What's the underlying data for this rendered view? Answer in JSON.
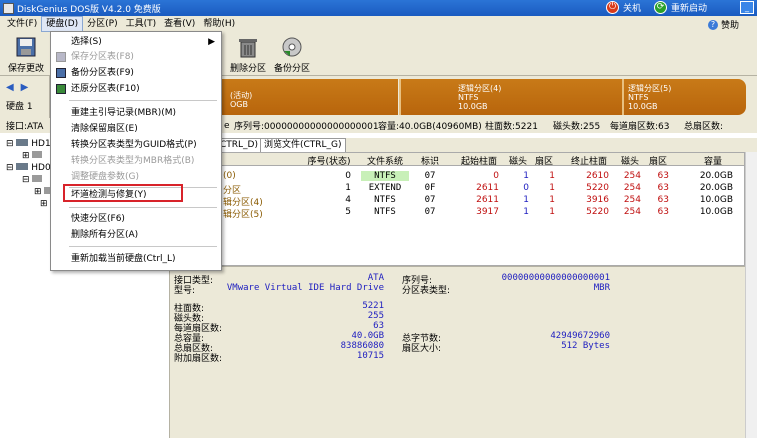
{
  "title": "DiskGenius DOS版 V4.2.0 免费版",
  "titlebar": {
    "shutdown": "关机",
    "restart": "重新启动"
  },
  "menubar": {
    "items": [
      "文件(F)",
      "硬盘(D)",
      "分区(P)",
      "工具(T)",
      "查看(V)",
      "帮助(H)"
    ],
    "donate": "赞助"
  },
  "toolbar": {
    "save_label": "保存更改",
    "delete_label": "删除分区",
    "backup_label": "备份分区"
  },
  "leftpanel": {
    "disk_label": "硬盘 1",
    "iface_label": "接口:ATA"
  },
  "diskbar": {
    "seg1_l1": "(活动)",
    "seg1_l2": "OGB",
    "seg2_l1": "逻辑分区(4)",
    "seg2_l2": "NTFS",
    "seg2_l3": "10.0GB",
    "seg3_l1": "逻辑分区(5)",
    "seg3_l2": "NTFS",
    "seg3_l3": "10.0GB"
  },
  "infoline": {
    "model_tail": "e",
    "serial": "序列号:00000000000000000001",
    "capacity": "容量:40.0GB(40960MB)",
    "cylinders": "柱面数:5221",
    "heads": "磁头数:255",
    "sectors": "每道扇区数:63",
    "total": "总扇区数:"
  },
  "tabs": {
    "t1": "CTRL_D)",
    "t2": "浏览文件(CTRL_G)"
  },
  "table": {
    "headers": [
      "序号(状态)",
      "文件系统",
      "标识",
      "起始柱面",
      "磁头",
      "扇区",
      "终止柱面",
      "磁头",
      "扇区",
      "容量"
    ],
    "rows": [
      {
        "name": "(0)",
        "idx": "0",
        "fs": "NTFS",
        "id": "07",
        "sc": "0",
        "sh": "1",
        "ss": "1",
        "ec": "2610",
        "eh": "254",
        "es": "63",
        "cap": "20.0GB"
      },
      {
        "name": "分区",
        "idx": "1",
        "fs": "EXTEND",
        "id": "0F",
        "sc": "2611",
        "sh": "0",
        "ss": "1",
        "ec": "5220",
        "eh": "254",
        "es": "63",
        "cap": "20.0GB"
      },
      {
        "name": "辑分区(4)",
        "idx": "4",
        "fs": "NTFS",
        "id": "07",
        "sc": "2611",
        "sh": "1",
        "ss": "1",
        "ec": "3916",
        "eh": "254",
        "es": "63",
        "cap": "10.0GB"
      },
      {
        "name": "辑分区(5)",
        "idx": "5",
        "fs": "NTFS",
        "id": "07",
        "sc": "3917",
        "sh": "1",
        "ss": "1",
        "ec": "5220",
        "eh": "254",
        "es": "63",
        "cap": "10.0GB"
      }
    ]
  },
  "details": {
    "iface_k": "接口类型:",
    "iface_v": "ATA",
    "model_k": "型号:",
    "model_v": "VMware Virtual IDE Hard Drive",
    "serial_k": "序列号:",
    "serial_v": "00000000000000000001",
    "ptype_k": "分区表类型:",
    "ptype_v": "MBR",
    "cyl_k": "柱面数:",
    "cyl_v": "5221",
    "heads_k": "磁头数:",
    "heads_v": "255",
    "spt_k": "每道扇区数:",
    "spt_v": "63",
    "cap_k": "总容量:",
    "cap_v": "40.0GB",
    "tsec_k": "总扇区数:",
    "tsec_v": "83886080",
    "extra_k": "附加扇区数:",
    "extra_v": "10715",
    "bytes_k": "总字节数:",
    "bytes_v": "42949672960",
    "ssize_k": "扇区大小:",
    "ssize_v": "512 Bytes"
  },
  "dropdown": {
    "items": [
      "选择(S)",
      "保存分区表(F8)",
      "备份分区表(F9)",
      "还原分区表(F10)",
      "重建主引导记录(MBR)(M)",
      "清除保留扇区(E)",
      "转换分区表类型为GUID格式(P)",
      "转换分区表类型为MBR格式(B)",
      "调整硬盘参数(G)",
      "坏道检测与修复(Y)",
      "快速分区(F6)",
      "删除所有分区(A)",
      "重新加载当前硬盘(Ctrl_L)"
    ]
  },
  "colors": {
    "titlebar": "#1a5bc0",
    "partition": "#b8650c",
    "highlight": "#d8232a",
    "ntfs_bg": "#c8f0b8",
    "data_blue": "#2020c0",
    "data_red": "#c01010"
  }
}
